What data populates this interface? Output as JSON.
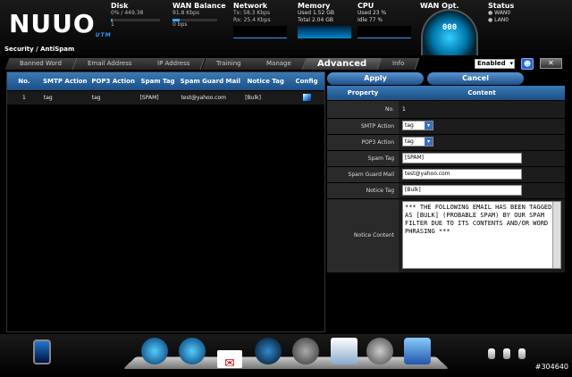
{
  "header": {
    "logo": "NUUO",
    "logo_sub": "UTM",
    "disk": {
      "title": "Disk",
      "value": "0% / 449.38",
      "sub": "1"
    },
    "wan_balance": {
      "title": "WAN Balance",
      "value": "91.8 Kbps",
      "sub": "0 bps"
    },
    "network": {
      "title": "Network",
      "tx": "Tx: 58.3 Kbps",
      "rx": "Rx: 25.4 Kbps"
    },
    "memory": {
      "title": "Memory",
      "used": "Used",
      "used_val": "1.52 GB",
      "total": "Total",
      "total_val": "2.04 GB"
    },
    "cpu": {
      "title": "CPU",
      "used": "Used",
      "used_val": "23 %",
      "idle": "Idle",
      "idle_val": "77 %"
    },
    "wan_opt": {
      "title": "WAN Opt.",
      "dial": "000"
    },
    "status": {
      "title": "Status",
      "wan": "WAN0",
      "lan": "LAN0"
    }
  },
  "breadcrumb": "Security / AntiSpam",
  "tabs": [
    "Banned Word",
    "Email Address",
    "IP Address",
    "Training",
    "Manage",
    "Advanced",
    "Info"
  ],
  "enabled": "Enabled",
  "table": {
    "headers": [
      "No.",
      "SMTP Action",
      "POP3 Action",
      "Spam Tag",
      "Spam Guard Mail",
      "Notice Tag",
      "Config"
    ],
    "rows": [
      [
        "1",
        "tag",
        "tag",
        "[SPAM]",
        "test@yahoo.com",
        "[Bulk]",
        ""
      ]
    ]
  },
  "buttons": {
    "apply": "Apply",
    "cancel": "Cancel"
  },
  "form": {
    "property_header": "Property",
    "content_header": "Content",
    "no_label": "No.",
    "no_value": "1",
    "smtp_label": "SMTP Action",
    "smtp_value": "tag",
    "pop3_label": "POP3 Action",
    "pop3_value": "tag",
    "spamtag_label": "Spam Tag",
    "spamtag_value": "[SPAM]",
    "guard_label": "Spam Guard Mail",
    "guard_value": "test@yahoo.com",
    "notice_label": "Notice Tag",
    "notice_value": "[Bulk]",
    "content_label": "Notice Content",
    "content_value": "*** THE FOLLOWING EMAIL HAS BEEN TAGGED AS [BULK] (PROBABLE SPAM) BY OUR SPAM FILTER DUE TO ITS CONTENTS AND/OR WORD PHRASING ***"
  },
  "footer_id": "#304640"
}
